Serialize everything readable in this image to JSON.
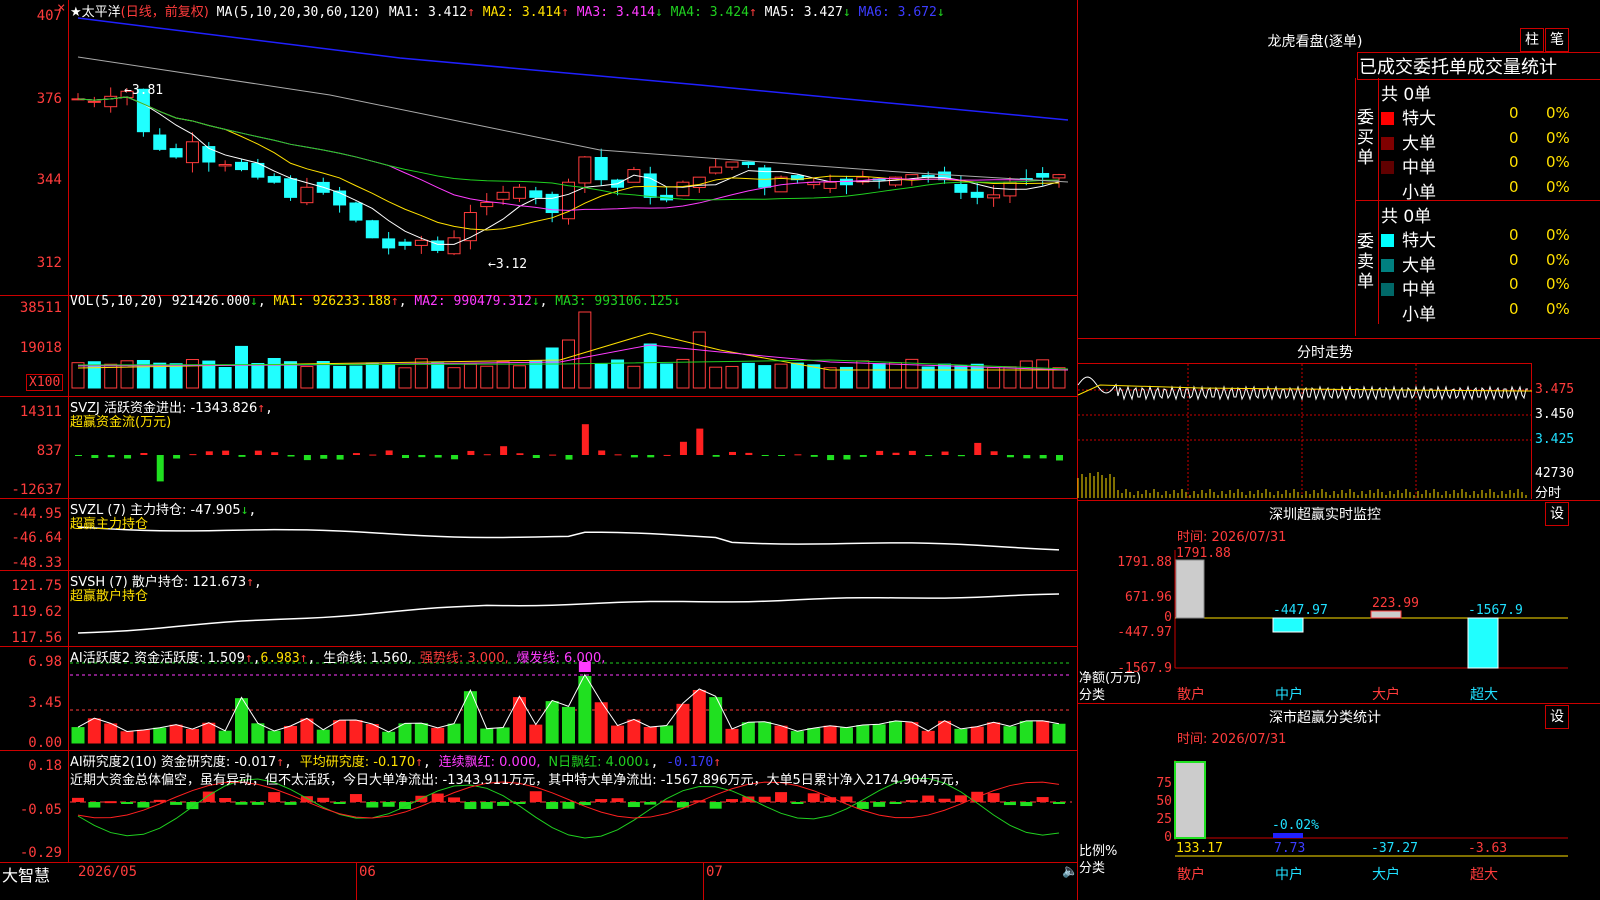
{
  "header": {
    "stock_name": "★太平洋",
    "period": "(日线，前复权)",
    "ma_label": "MA(5,10,20,30,60,120)",
    "ma1": "MA1: 3.412",
    "ma2": "MA2: 3.414",
    "ma3": "MA3: 3.414",
    "ma4": "MA4: 3.424",
    "ma5": "MA5: 3.427",
    "ma6": "MA6: 3.672",
    "up_arrow": "↑",
    "down_arrow": "↓",
    "close_symbol": "×"
  },
  "price_axis": [
    "407",
    "376",
    "344",
    "312"
  ],
  "price_marks": {
    "high": "3.81",
    "low": "3.12"
  },
  "vol": {
    "label": "VOL(5,10,20)",
    "val": "921426.000",
    "ma1": "MA1: 926233.188",
    "ma2": "MA2: 990479.312",
    "ma3": "MA3: 993106.125",
    "axis": [
      "38511",
      "19018"
    ],
    "unit": "X100"
  },
  "svzj": {
    "label": "SVZJ  活跃资金进出: -1343.826",
    "sub": "超赢资金流(万元)",
    "axis": [
      "14311",
      "837",
      "-12637"
    ]
  },
  "svzl": {
    "label": "SVZL (7) 主力持仓: -47.905",
    "sub": "超赢主力持仓",
    "axis": [
      "-44.95",
      "-46.64",
      "-48.33"
    ]
  },
  "svsh": {
    "label": "SVSH (7) 散户持仓: 121.673",
    "sub": "超赢散户持仓",
    "axis": [
      "121.75",
      "119.62",
      "117.56"
    ]
  },
  "ai_active": {
    "label1": "AI活跃度2 资金活跃度: 1.509",
    "label2": "6.983",
    "life": "生命线: 1.560,",
    "strong": "强势线: 3.000,",
    "burst": "爆发线: 6.000,",
    "axis": [
      "6.98",
      "3.45",
      "0.00"
    ]
  },
  "ai_research": {
    "label": "AI研究度2(10) 资金研究度: -0.017",
    "avg": "平均研究度: -0.170",
    "lianxu": "连续飘红: 0.000,",
    "nday": "N日飘红: 4.000",
    "last": "-0.170",
    "comment": "近期大资金总体偏空，虽有异动，但不太活跃，今日大单净流出: -1343.911万元，其中特大单净流出: -1567.896万元，大单5日累计净入2174.904万元，",
    "axis": [
      "0.18",
      "-0.05",
      "-0.29"
    ]
  },
  "date_axis": {
    "brand": "大智慧",
    "d1": "2026/05",
    "d2": "06",
    "d3": "07"
  },
  "right": {
    "lhkp_title": "龙虎看盘(逐单)",
    "btn_zhu": "柱",
    "btn_bi": "笔",
    "tabs": "已成交委托单成交量统计",
    "buy": {
      "label": "委买单",
      "total": "共 0单",
      "rows": [
        {
          "name": "特大",
          "n": "0",
          "p": "0%",
          "color": "#ff0000"
        },
        {
          "name": "大单",
          "n": "0",
          "p": "0%",
          "color": "#800000"
        },
        {
          "name": "中单",
          "n": "0",
          "p": "0%",
          "color": "#600000"
        },
        {
          "name": "小单",
          "n": "0",
          "p": "0%",
          "color": "#000000"
        }
      ]
    },
    "sell": {
      "label": "委卖单",
      "total": "共 0单",
      "rows": [
        {
          "name": "特大",
          "n": "0",
          "p": "0%",
          "color": "#00ffff"
        },
        {
          "name": "大单",
          "n": "0",
          "p": "0%",
          "color": "#008080"
        },
        {
          "name": "中单",
          "n": "0",
          "p": "0%",
          "color": "#006868"
        },
        {
          "name": "小单",
          "n": "0",
          "p": "0%",
          "color": "#000000"
        }
      ]
    },
    "fs_title": "分时走势",
    "fs_axis": [
      "3.475",
      "3.450",
      "3.425",
      "42730"
    ],
    "fs_unit": "分时",
    "sz_title": "深圳超赢实时监控",
    "btn_set": "设",
    "sz_time": "时间: 2026/07/31",
    "sz_axis": [
      "1791.88",
      "671.96",
      "0",
      "-447.97",
      "-1567.9"
    ],
    "sz_values": [
      "1791.88",
      "-447.97",
      "223.99",
      "-1567.9"
    ],
    "sz_unit": "净额(万元)",
    "sz_cat_label": "分类",
    "sz_cats": [
      "散户",
      "中户",
      "大户",
      "超大"
    ],
    "fl_title": "深市超赢分类统计",
    "fl_time": "时间: 2026/07/31",
    "fl_axis": [
      "75",
      "50",
      "25",
      "0"
    ],
    "fl_values": [
      "133.17",
      "7.73",
      "-37.27",
      "-3.63"
    ],
    "fl_small": "-0.02%",
    "fl_unit": "比例%",
    "fl_cat_label": "分类",
    "fl_cats": [
      "散户",
      "中户",
      "大户",
      "超大"
    ]
  }
}
